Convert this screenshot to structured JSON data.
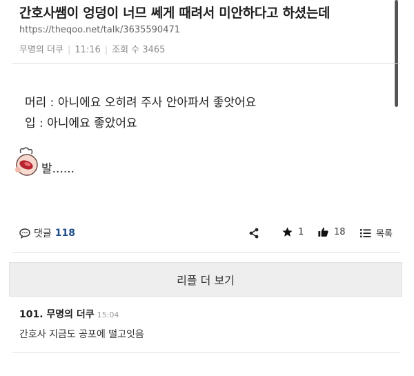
{
  "post": {
    "title": "간호사쌤이 엉덩이 너므 쎄게 때려서 미안하다고 하셨는데",
    "url": "https://theqoo.net/talk/3635590471",
    "author": "무명의 더쿠",
    "time": "11:16",
    "views_label": "조회 수 3465"
  },
  "content": {
    "line1": "머리 : 아니에요 오히려 주사 안아파서 좋앗어요",
    "line2": "입 : 아니에요 좋았어요",
    "sticker_text": "발......"
  },
  "actions": {
    "comment_label": "댓글",
    "comment_count": "118",
    "star_count": "1",
    "like_count": "18",
    "list_label": "목록"
  },
  "replies": {
    "more_label": "리플 더 보기",
    "items": [
      {
        "header": "101. 무명의 더쿠",
        "time": "15:04",
        "body": "간호사 지금도 공포에 떨고잇음"
      }
    ]
  },
  "colors": {
    "accent": "#1f4f8a",
    "muted": "#8a8a8a",
    "button_bg": "#eeeeee"
  }
}
